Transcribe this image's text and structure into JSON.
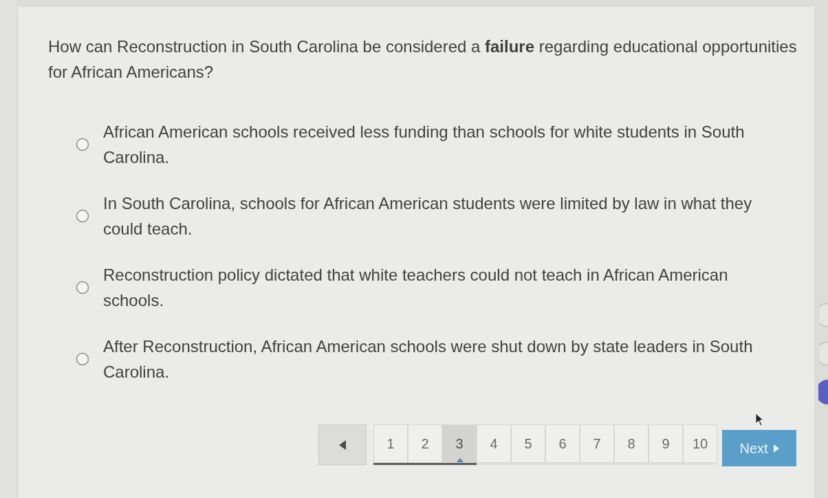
{
  "question": {
    "text": "How can Reconstruction in South Carolina be considered a **failure** regarding educational opportunities for African Americans?"
  },
  "options": [
    {
      "text": "African American schools received less funding than schools for white students in South Carolina.",
      "selected": false
    },
    {
      "text": "In South Carolina, schools for African American students were limited by law in what they could teach.",
      "selected": false
    },
    {
      "text": "Reconstruction policy dictated that white teachers could not teach in African American schools.",
      "selected": false
    },
    {
      "text": "After Reconstruction, African American schools were shut down by state leaders in South Carolina.",
      "selected": false
    }
  ],
  "pagination": {
    "pages": [
      {
        "label": "1",
        "selected": false
      },
      {
        "label": "2",
        "selected": false
      },
      {
        "label": "3",
        "selected": true
      },
      {
        "label": "4",
        "selected": false
      },
      {
        "label": "5",
        "selected": false
      },
      {
        "label": "6",
        "selected": false
      },
      {
        "label": "7",
        "selected": false
      },
      {
        "label": "8",
        "selected": false
      },
      {
        "label": "9",
        "selected": false
      },
      {
        "label": "10",
        "selected": false
      }
    ],
    "progress": {
      "level": 0.3
    },
    "next": "Next"
  }
}
